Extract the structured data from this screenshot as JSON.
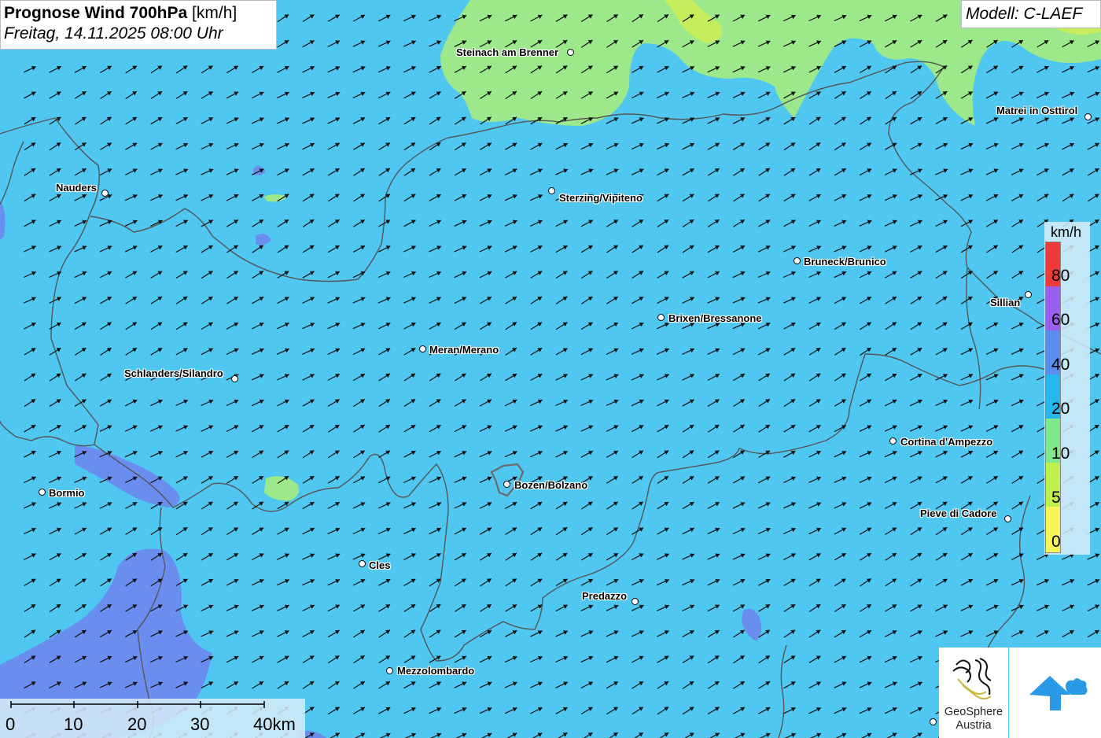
{
  "header": {
    "title_bold": "Prognose Wind 700hPa",
    "title_unit": "[km/h]",
    "subtitle": "Freitag, 14.11.2025 08:00 Uhr"
  },
  "model": {
    "label": "Modell: C-LAEF"
  },
  "legend": {
    "unit": "km/h",
    "labels": [
      "80",
      "60",
      "40",
      "20",
      "10",
      "5",
      "0"
    ],
    "colors": [
      "#f03a3a",
      "#9a5ff0",
      "#5a8df0",
      "#25b8ec",
      "#7fe88a",
      "#bff04e",
      "#f5f55a"
    ]
  },
  "cities": [
    {
      "name": "Steinach am Brenner"
    },
    {
      "name": "Matrei in Osttirol"
    },
    {
      "name": "Nauders"
    },
    {
      "name": "Sterzing/Vipiteno"
    },
    {
      "name": "Bruneck/Brunico"
    },
    {
      "name": "Sillian"
    },
    {
      "name": "Brixen/Bressanone"
    },
    {
      "name": "Meran/Merano"
    },
    {
      "name": "Schlanders/Silandro"
    },
    {
      "name": "Cortina d'Ampezzo"
    },
    {
      "name": "Bozen/Bolzano"
    },
    {
      "name": "Bormio"
    },
    {
      "name": "Pieve di Cadore"
    },
    {
      "name": "Cles"
    },
    {
      "name": "Predazzo"
    },
    {
      "name": "Mezzolombardo"
    }
  ],
  "scale": {
    "labels": [
      "0",
      "10",
      "20",
      "30",
      "40km"
    ]
  },
  "branding": {
    "geosphere_line1": "GeoSphere",
    "geosphere_line2": "Austria"
  },
  "colors": {
    "wind_20_40": "#4fc7f0",
    "wind_10_20": "#9ce88a",
    "wind_5_10": "#c6ee5c",
    "wind_40_60": "#6a8ef0",
    "border": "#555555"
  },
  "arrows": {
    "icon": "wind-arrow-icon"
  }
}
